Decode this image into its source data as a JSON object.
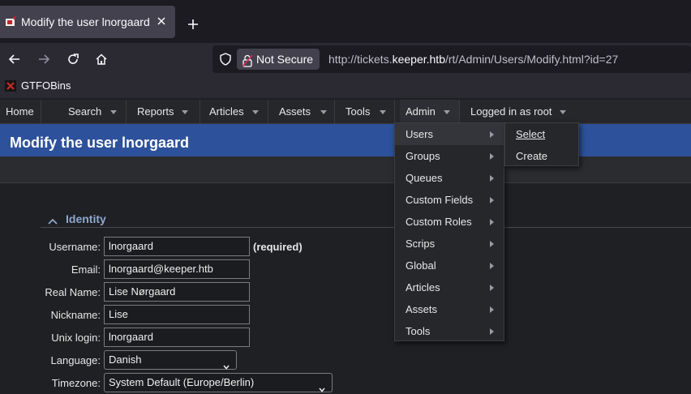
{
  "browser": {
    "tab_title": "Modify the user lnorgaard",
    "security_label": "Not Secure",
    "url_prefix": "http://tickets.",
    "url_domain": "keeper.htb",
    "url_path": "/rt/Admin/Users/Modify.html?id=27",
    "bookmark": "GTFOBins"
  },
  "menubar": {
    "items": [
      "Home",
      "Search",
      "Reports",
      "Articles",
      "Assets",
      "Tools",
      "Admin",
      "Logged in as root"
    ]
  },
  "page": {
    "title": "Modify the user lnorgaard",
    "section_title": "Identity",
    "required_note": "(required)"
  },
  "form": {
    "username": {
      "label": "Username:",
      "value": "lnorgaard"
    },
    "email": {
      "label": "Email:",
      "value": "lnorgaard@keeper.htb"
    },
    "realname": {
      "label": "Real Name:",
      "value": "Lise Nørgaard"
    },
    "nickname": {
      "label": "Nickname:",
      "value": "Lise"
    },
    "unixlogin": {
      "label": "Unix login:",
      "value": "lnorgaard"
    },
    "language": {
      "label": "Language:",
      "value": "Danish"
    },
    "timezone": {
      "label": "Timezone:",
      "value": "System Default (Europe/Berlin)"
    }
  },
  "admin_menu": {
    "items": [
      "Users",
      "Groups",
      "Queues",
      "Custom Fields",
      "Custom Roles",
      "Scrips",
      "Global",
      "Articles",
      "Assets",
      "Tools"
    ]
  },
  "users_submenu": {
    "items": [
      "Select",
      "Create"
    ]
  },
  "colors": {
    "title_bar": "#2d519a",
    "section_title": "#8fa8cf",
    "page_bg": "#1f2023"
  }
}
